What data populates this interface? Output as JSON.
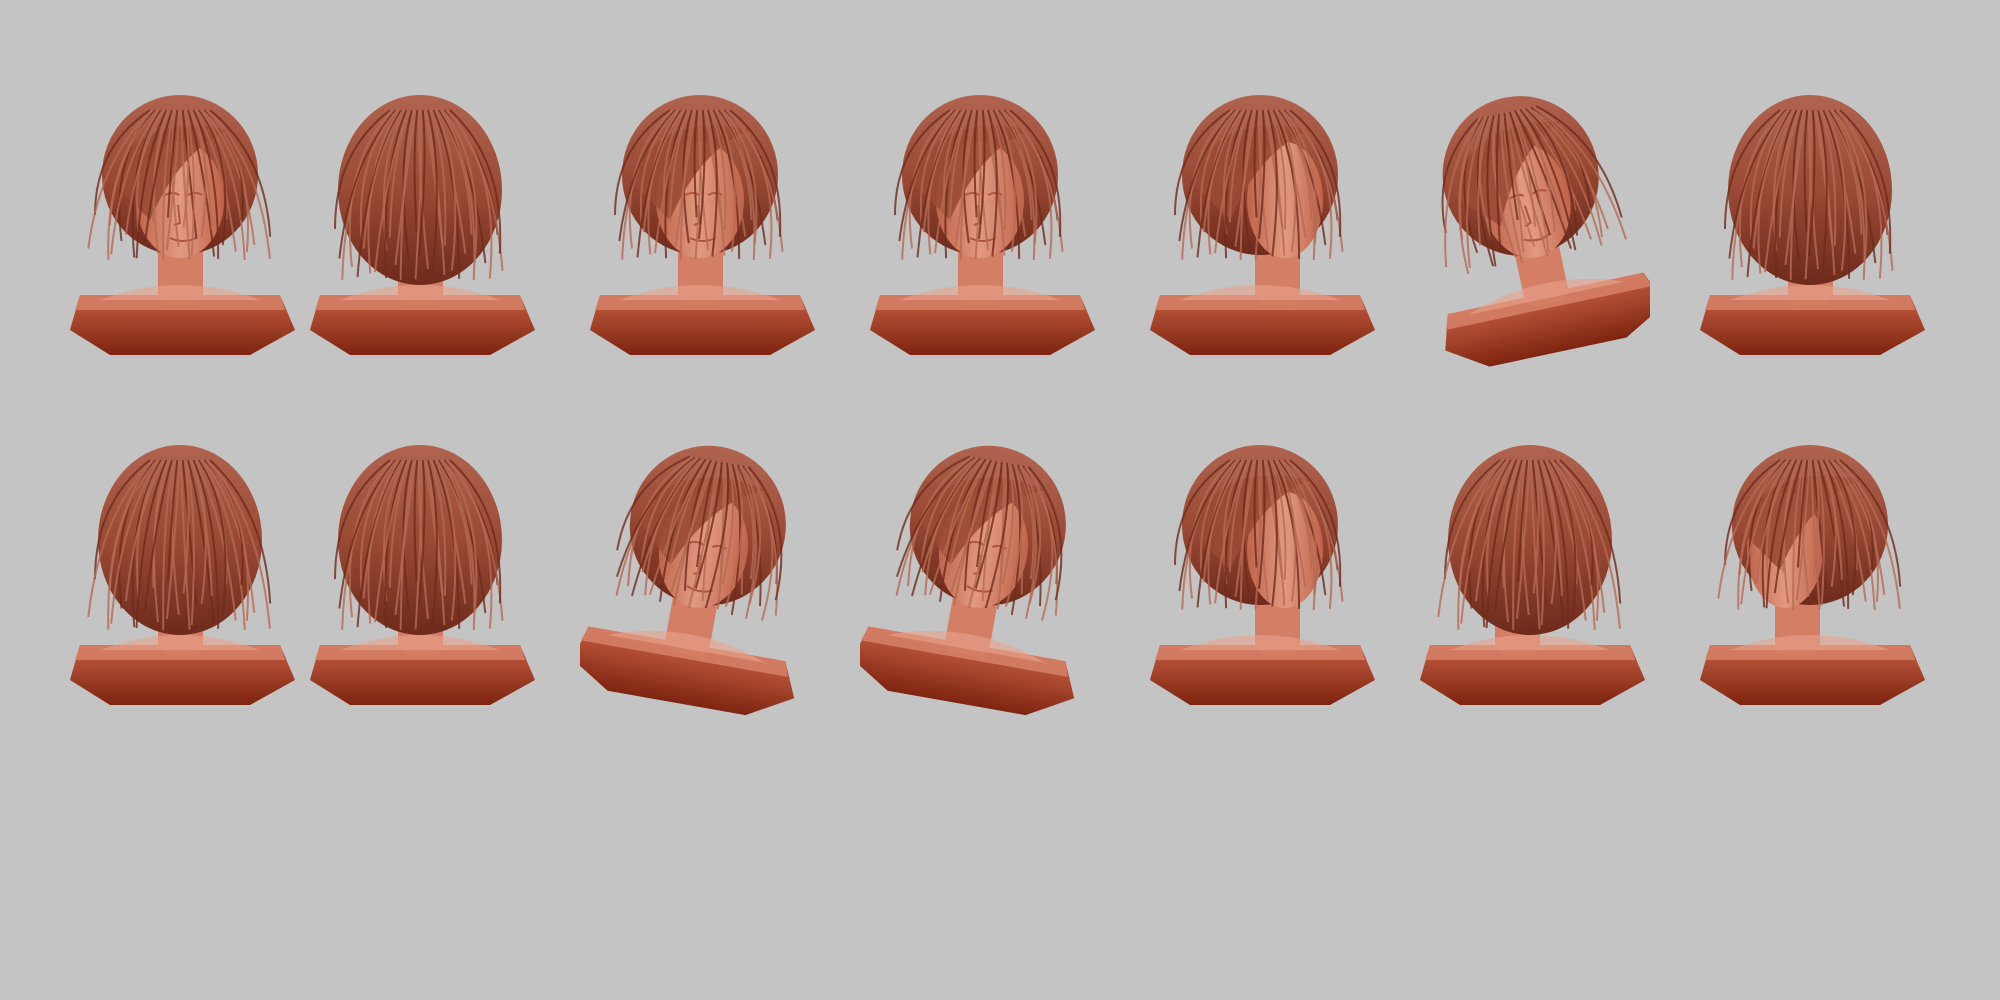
{
  "scene": {
    "background_color": "#c4c4c4",
    "material_colors": {
      "hair": "#9a4a34",
      "hair_dark": "#6e2a1c",
      "hair_light": "#b56a52",
      "skin": "#d47e66",
      "skin_shade": "#b2553e",
      "skin_light": "#e8a48c",
      "base_side": "#8e2a14",
      "base_top": "#c05b40"
    },
    "rows": [
      {
        "busts": [
          {
            "view": "front-left"
          },
          {
            "view": "back-top"
          },
          {
            "view": "front"
          },
          {
            "view": "front"
          },
          {
            "view": "right-profile"
          },
          {
            "view": "left-three-quarter-tilted"
          },
          {
            "view": "back-right"
          }
        ]
      },
      {
        "busts": [
          {
            "view": "back-left"
          },
          {
            "view": "back"
          },
          {
            "view": "front-tilted"
          },
          {
            "view": "top-down-tilted"
          },
          {
            "view": "right-profile-low"
          },
          {
            "view": "left-back-profile"
          },
          {
            "view": "left-profile"
          }
        ]
      }
    ]
  }
}
